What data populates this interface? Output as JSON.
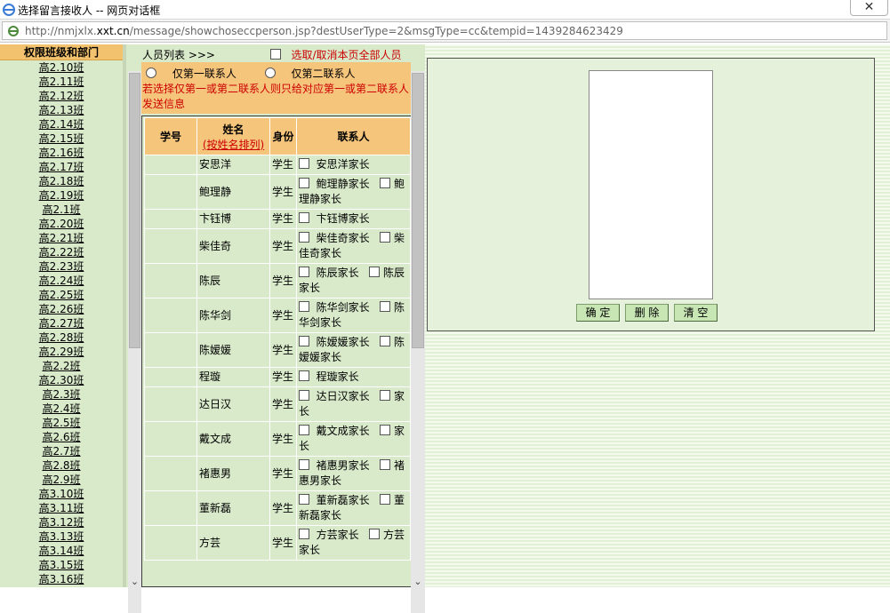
{
  "window": {
    "title": "选择留言接收人 -- 网页对话框",
    "close_label": "✕"
  },
  "address": {
    "url_prefix": "http://nmjxlx.",
    "url_domain": "xxt.cn",
    "url_rest": "/message/showchoseccperson.jsp?destUserType=2&msgType=cc&tempid=1439284623429"
  },
  "left": {
    "header": "权限班级和部门",
    "classes": [
      "高2.10班",
      "高2.11班",
      "高2.12班",
      "高2.13班",
      "高2.14班",
      "高2.15班",
      "高2.16班",
      "高2.17班",
      "高2.18班",
      "高2.19班",
      "高2.1班",
      "高2.20班",
      "高2.21班",
      "高2.22班",
      "高2.23班",
      "高2.24班",
      "高2.25班",
      "高2.26班",
      "高2.27班",
      "高2.28班",
      "高2.29班",
      "高2.2班",
      "高2.30班",
      "高2.3班",
      "高2.4班",
      "高2.5班",
      "高2.6班",
      "高2.7班",
      "高2.8班",
      "高2.9班",
      "高3.10班",
      "高3.11班",
      "高3.12班",
      "高3.13班",
      "高3.14班",
      "高3.15班",
      "高3.16班"
    ]
  },
  "middle": {
    "title": "人员列表 >>>",
    "select_all": "选取/取消本页全部人员",
    "radio1": "仅第一联系人",
    "radio2": "仅第二联系人",
    "note": "若选择仅第一或第二联系人则只给对应第一或第二联系人发送信息",
    "headers": {
      "id": "学号",
      "name": "姓名",
      "sort": "(按姓名排列)",
      "role": "身份",
      "contact": "联系人"
    },
    "rows": [
      {
        "name": "安思洋",
        "role": "学生",
        "c1": "安思洋家长",
        "c2": ""
      },
      {
        "name": "鲍理静",
        "role": "学生",
        "c1": "鲍理静家长",
        "c2": "鲍理静家长"
      },
      {
        "name": "卞钰博",
        "role": "学生",
        "c1": "卞钰博家长",
        "c2": ""
      },
      {
        "name": "柴佳奇",
        "role": "学生",
        "c1": "柴佳奇家长",
        "c2": "柴佳奇家长"
      },
      {
        "name": "陈辰",
        "role": "学生",
        "c1": "陈辰家长",
        "c2": "陈辰家长"
      },
      {
        "name": "陈华剑",
        "role": "学生",
        "c1": "陈华剑家长",
        "c2": "陈华剑家长"
      },
      {
        "name": "陈嫒媛",
        "role": "学生",
        "c1": "陈嫒媛家长",
        "c2": "陈嫒媛家长"
      },
      {
        "name": "程璇",
        "role": "学生",
        "c1": "程璇家长",
        "c2": ""
      },
      {
        "name": "达日汉",
        "role": "学生",
        "c1": "达日汉家长",
        "c2": "家长"
      },
      {
        "name": "戴文成",
        "role": "学生",
        "c1": "戴文成家长",
        "c2": "家长"
      },
      {
        "name": "褚惠男",
        "role": "学生",
        "c1": "褚惠男家长",
        "c2": "褚惠男家长"
      },
      {
        "name": "董新磊",
        "role": "学生",
        "c1": "董新磊家长",
        "c2": "董新磊家长"
      },
      {
        "name": "方芸",
        "role": "学生",
        "c1": "方芸家长",
        "c2": "方芸家长"
      }
    ]
  },
  "right": {
    "confirm": "确 定",
    "delete": "删 除",
    "clear": "清 空"
  }
}
